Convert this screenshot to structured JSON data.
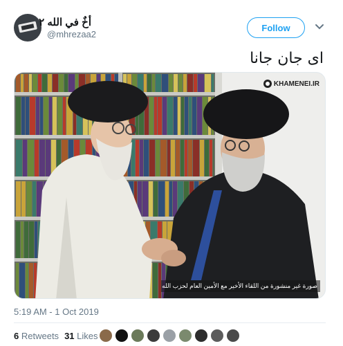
{
  "header": {
    "display_name": "أخٌ في الله ٢",
    "username": "@mhrezaa2",
    "follow_label": "Follow",
    "icons": [
      "avatar",
      "chevron-down-icon"
    ]
  },
  "tweet": {
    "text": "ای جان جانا",
    "timestamp": "5:19 AM - 1 Oct 2019"
  },
  "photo": {
    "watermark": "KHAMENEI.IR",
    "caption": "صورة غير منشورة من اللقاء الأخير مع الأمين العام لحزب الله في لبنان السيد حسن نصرالله"
  },
  "stats": {
    "retweets_count": "6",
    "retweets_label": "Retweets",
    "likes_count": "31",
    "likes_label": "Likes"
  },
  "likers": [
    {
      "color": "#8a6a4a"
    },
    {
      "color": "#111111"
    },
    {
      "color": "#6b7a5a"
    },
    {
      "color": "#3b3b3b"
    },
    {
      "color": "#9aa0a6"
    },
    {
      "color": "#7b8a6e"
    },
    {
      "color": "#2d2d2d"
    },
    {
      "color": "#5c5c5c"
    },
    {
      "color": "#4a4a4a"
    }
  ],
  "colors": {
    "accent": "#1da1f2",
    "muted": "#657786"
  }
}
